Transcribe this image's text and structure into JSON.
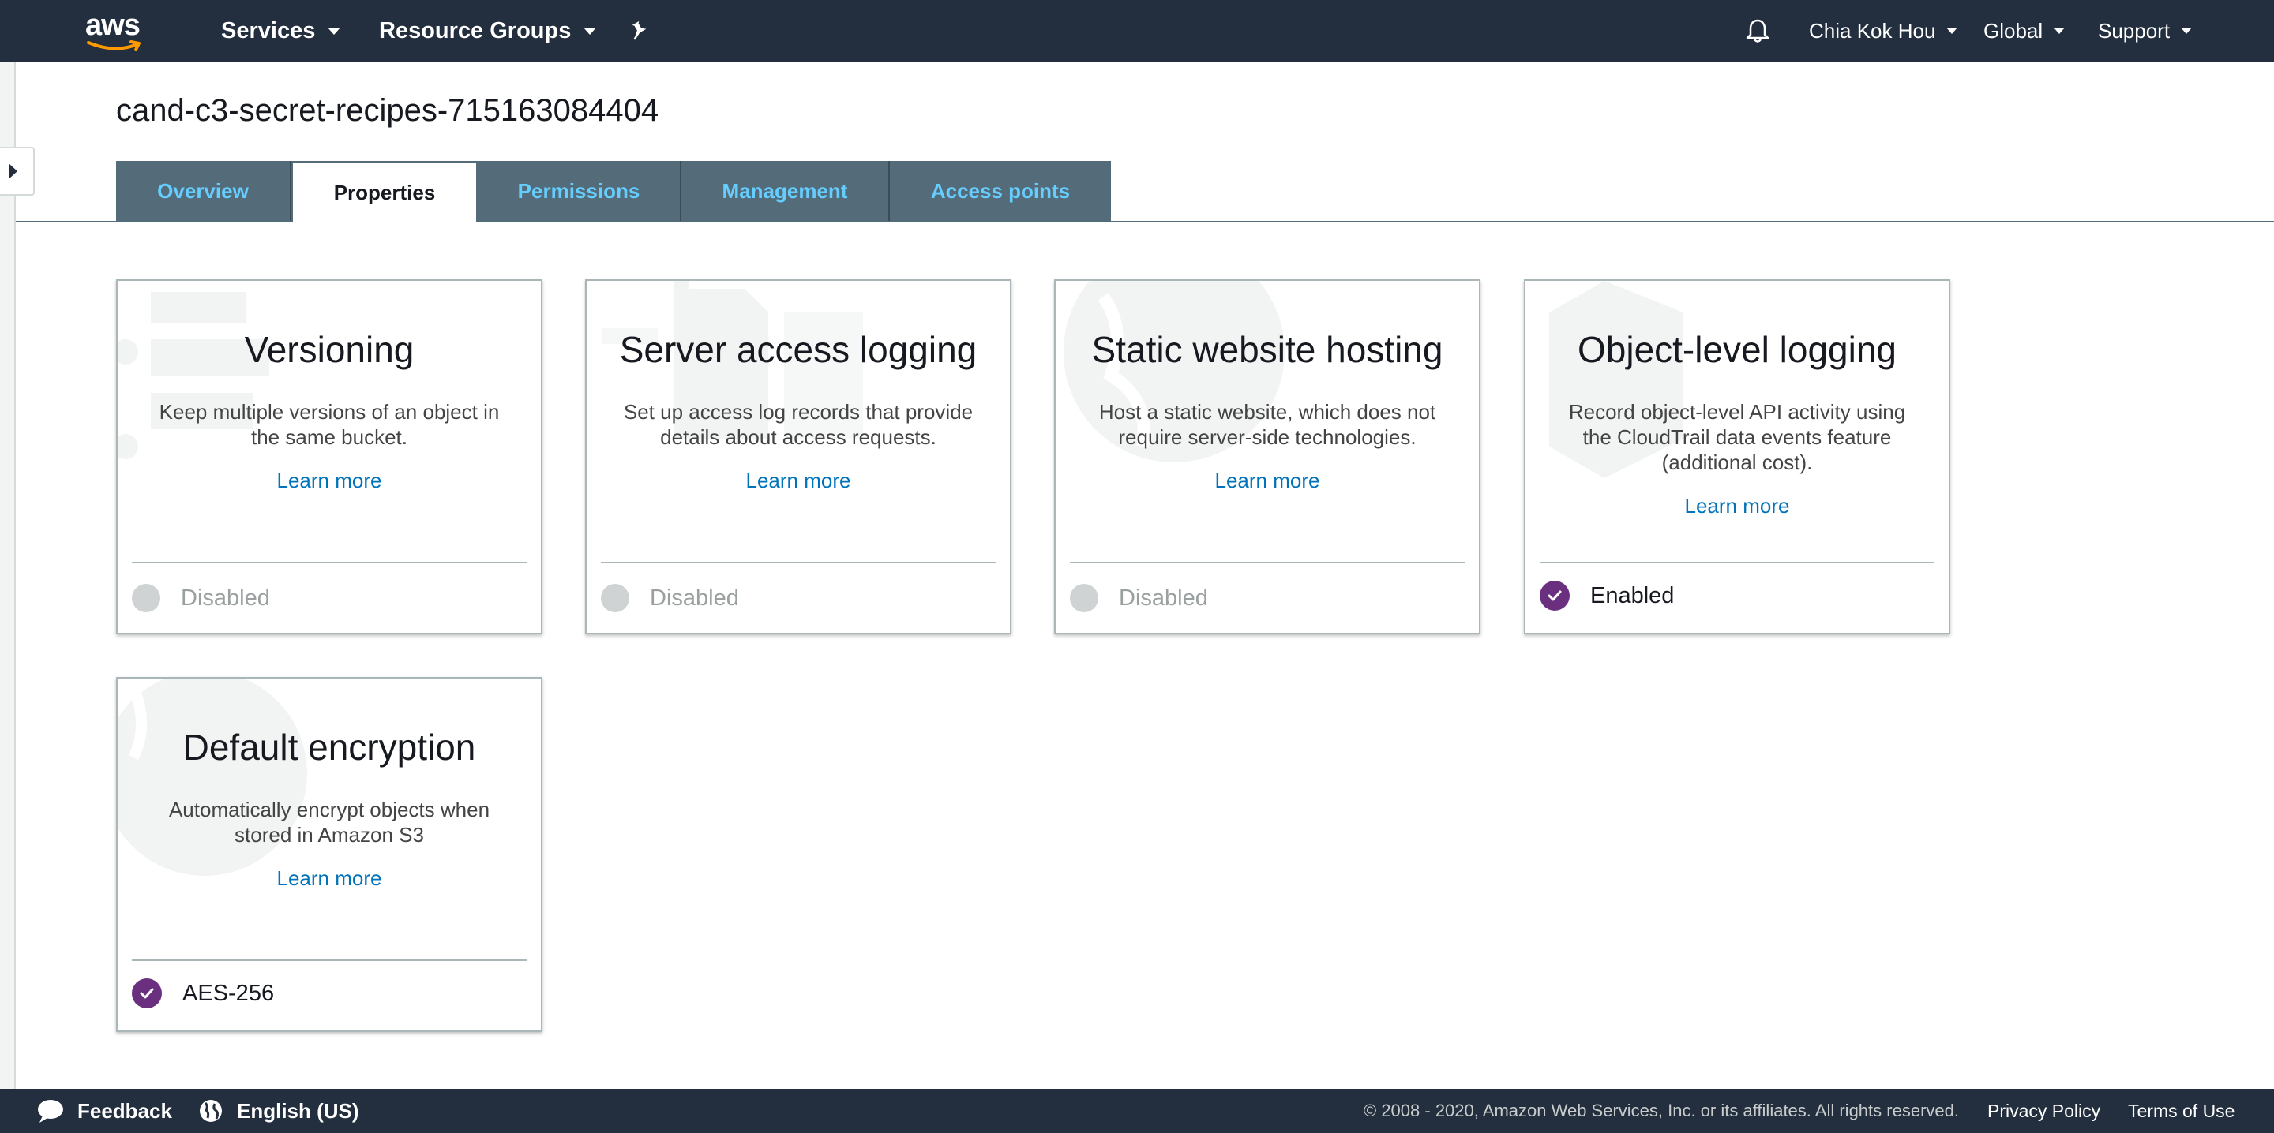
{
  "topnav": {
    "logo_text": "aws",
    "services_label": "Services",
    "resource_groups_label": "Resource Groups",
    "user_label": "Chia Kok Hou",
    "region_label": "Global",
    "support_label": "Support",
    "icons": {
      "pin": "pin-icon",
      "bell": "notification-bell-icon"
    }
  },
  "bucket": {
    "name": "cand-c3-secret-recipes-715163084404"
  },
  "tabs": [
    {
      "label": "Overview",
      "active": false
    },
    {
      "label": "Properties",
      "active": true
    },
    {
      "label": "Permissions",
      "active": false
    },
    {
      "label": "Management",
      "active": false
    },
    {
      "label": "Access points",
      "active": false
    }
  ],
  "cards": [
    {
      "title": "Versioning",
      "description": "Keep multiple versions of an object in the same bucket.",
      "learn_more": "Learn more",
      "status": "Disabled",
      "enabled": false
    },
    {
      "title": "Server access logging",
      "description": "Set up access log records that provide details about access requests.",
      "learn_more": "Learn more",
      "status": "Disabled",
      "enabled": false
    },
    {
      "title": "Static website hosting",
      "description": "Host a static website, which does not require server-side technologies.",
      "learn_more": "Learn more",
      "status": "Disabled",
      "enabled": false
    },
    {
      "title": "Object-level logging",
      "description": "Record object-level API activity using the CloudTrail data events feature (additional cost).",
      "learn_more": "Learn more",
      "status": "Enabled",
      "enabled": true
    },
    {
      "title": "Default encryption",
      "description": "Automatically encrypt objects when stored in Amazon S3",
      "learn_more": "Learn more",
      "status": "AES-256",
      "enabled": true
    }
  ],
  "footer": {
    "feedback_label": "Feedback",
    "language_label": "English (US)",
    "copyright": "© 2008 - 2020, Amazon Web Services, Inc. or its affiliates. All rights reserved.",
    "privacy_label": "Privacy Policy",
    "terms_label": "Terms of Use"
  },
  "colors": {
    "nav_bg": "#232f3e",
    "tab_bg": "#546b7a",
    "tab_text": "#66cefe",
    "link": "#0073bb",
    "enabled_dot": "#6b2f80",
    "disabled_dot": "#cfd3d3"
  }
}
